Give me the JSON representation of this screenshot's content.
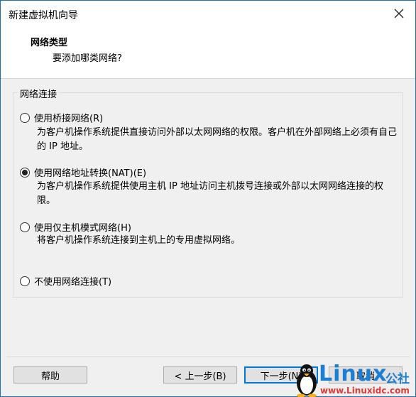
{
  "window": {
    "title": "新建虚拟机向导"
  },
  "header": {
    "title": "网络类型",
    "subtitle": "要添加哪类网络?"
  },
  "group": {
    "label": "网络连接"
  },
  "options": [
    {
      "label": "使用桥接网络(R)",
      "checked": false,
      "description": "为客户机操作系统提供直接访问外部以太网网络的权限。客户机在外部网络上必须有自己的 IP 地址。"
    },
    {
      "label": "使用网络地址转换(NAT)(E)",
      "checked": true,
      "description": "为客户机操作系统提供使用主机 IP 地址访问主机拨号连接或外部以太网网络连接的权限。"
    },
    {
      "label": "使用仅主机模式网络(H)",
      "checked": false,
      "description": "将客户机操作系统连接到主机上的专用虚拟网络。"
    },
    {
      "label": "不使用网络连接(T)",
      "checked": false,
      "description": ""
    }
  ],
  "buttons": {
    "help": "帮助",
    "back": "< 上一步(B)",
    "next": "下一步(N)",
    "cancel": "取消"
  },
  "watermark": {
    "brand": "Linux",
    "brand_suffix": "公社",
    "url": "www.Linuxidc.com"
  }
}
